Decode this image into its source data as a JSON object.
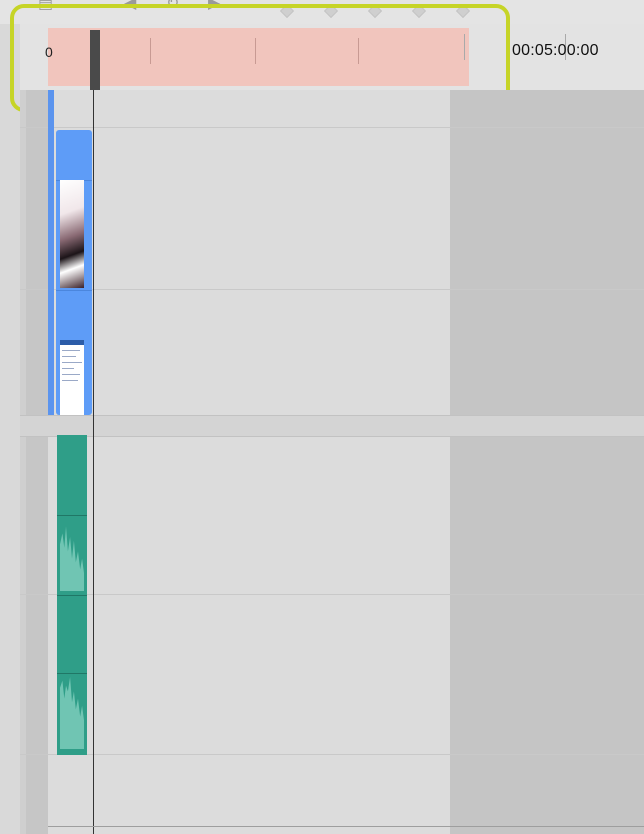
{
  "ruler": {
    "start_label": "0",
    "time_label": "00:05:00:00"
  },
  "toolbar": {
    "icons": [
      "rewind-icon",
      "loop-icon",
      "forward-icon",
      "keyframe-diamond-icon"
    ]
  },
  "tracks": {
    "video": {
      "clips": [
        "video-clip-1",
        "video-clip-2"
      ],
      "color": "#5e9cf7"
    },
    "audio": {
      "clips": [
        "audio-clip-1",
        "audio-clip-2"
      ],
      "color": "#2f9e88"
    }
  },
  "colors": {
    "work_area": "#f1c5bd",
    "highlight": "#c6d427",
    "out_of_range": "#c5c5c5"
  }
}
